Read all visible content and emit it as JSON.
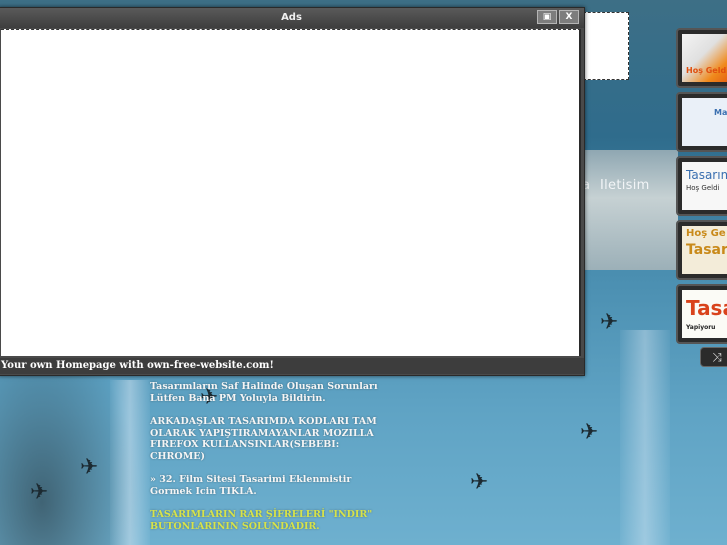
{
  "ads_window": {
    "title": "Ads",
    "restore_label": "▣",
    "close_label": "X",
    "footer_text": "Your own Homepage with own-free-website.com!"
  },
  "background": {
    "nav_left": "a",
    "nav_item": "Iletisim"
  },
  "thumbnails": [
    {
      "label": "Hoş Geldi",
      "accent": "#f08a1c"
    },
    {
      "label": "Ma",
      "accent": "#3a6fb0"
    },
    {
      "label": "Tasarım",
      "sub": "Hoş Geldi",
      "accent": "#3a6fb0"
    },
    {
      "label": "Hoş Ge",
      "sub": "Tasarım",
      "accent": "#c98a1a"
    },
    {
      "label": "Tasa",
      "sub": "Yapiyoru",
      "accent": "#d9431c"
    }
  ],
  "shuffle_icon": "shuffle-icon",
  "main_text": {
    "p1": "Tasarımların Saf Halinde Oluşan Sorunları Lütfen Bana PM Yoluyla Bildirin.",
    "p2": "ARKADAŞLAR TASARIMDA KODLARI TAM OLARAK YAPIŞTIRAMAYANLAR MOZILLA FIREFOX KULLANSINLAR(SEBEBI: CHROME)",
    "p3": "» 32. Film Sitesi Tasarimi Eklenmistir Gormek Icin TIKLA.",
    "p4": "TASARIMLARIN RAR ŞİFRELERİ \"INDIR\" BUTONLARININ SOLUNDADIR."
  },
  "colors": {
    "highlight_yellow": "#d7e34a",
    "window_gray": "#4a4a4a"
  }
}
